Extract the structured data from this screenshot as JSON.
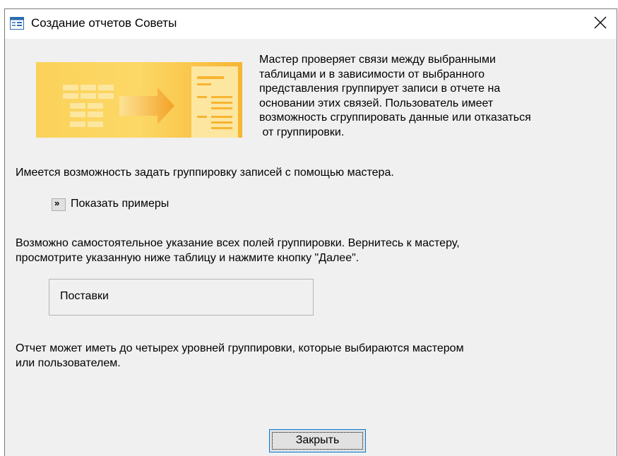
{
  "window": {
    "title": "Создание отчетов Советы",
    "icon": "form-window-icon",
    "close_icon": "close-icon"
  },
  "description": [
    "Мастер проверяет связи между выбранными",
    "таблицами и в зависимости от выбранного",
    "представления группирует записи в отчете на",
    "основании этих связей. Пользователь имеет",
    "возможность сгруппировать данные или отказаться",
    " от группировки."
  ],
  "wizard_grouping_text": "Имеется возможность задать группировку записей с помощью мастера.",
  "show_examples": {
    "button_glyph": "»",
    "label": "Показать примеры"
  },
  "manual_grouping_text": [
    "Возможно самостоятельное указание всех полей группировки. Вернитесь к мастеру,",
    "просмотрите указанную ниже таблицу и нажмите кнопку \"Далее\"."
  ],
  "table_name": "Поставки",
  "levels_text": [
    "Отчет может иметь до четырех уровней группировки, которые выбираются мастером",
    "или пользователем."
  ],
  "buttons": {
    "close_label": "Закрыть"
  },
  "colors": {
    "banner_orange": "#f7a51e",
    "banner_yellow": "#fde58a",
    "focus_border": "#0078d7"
  }
}
